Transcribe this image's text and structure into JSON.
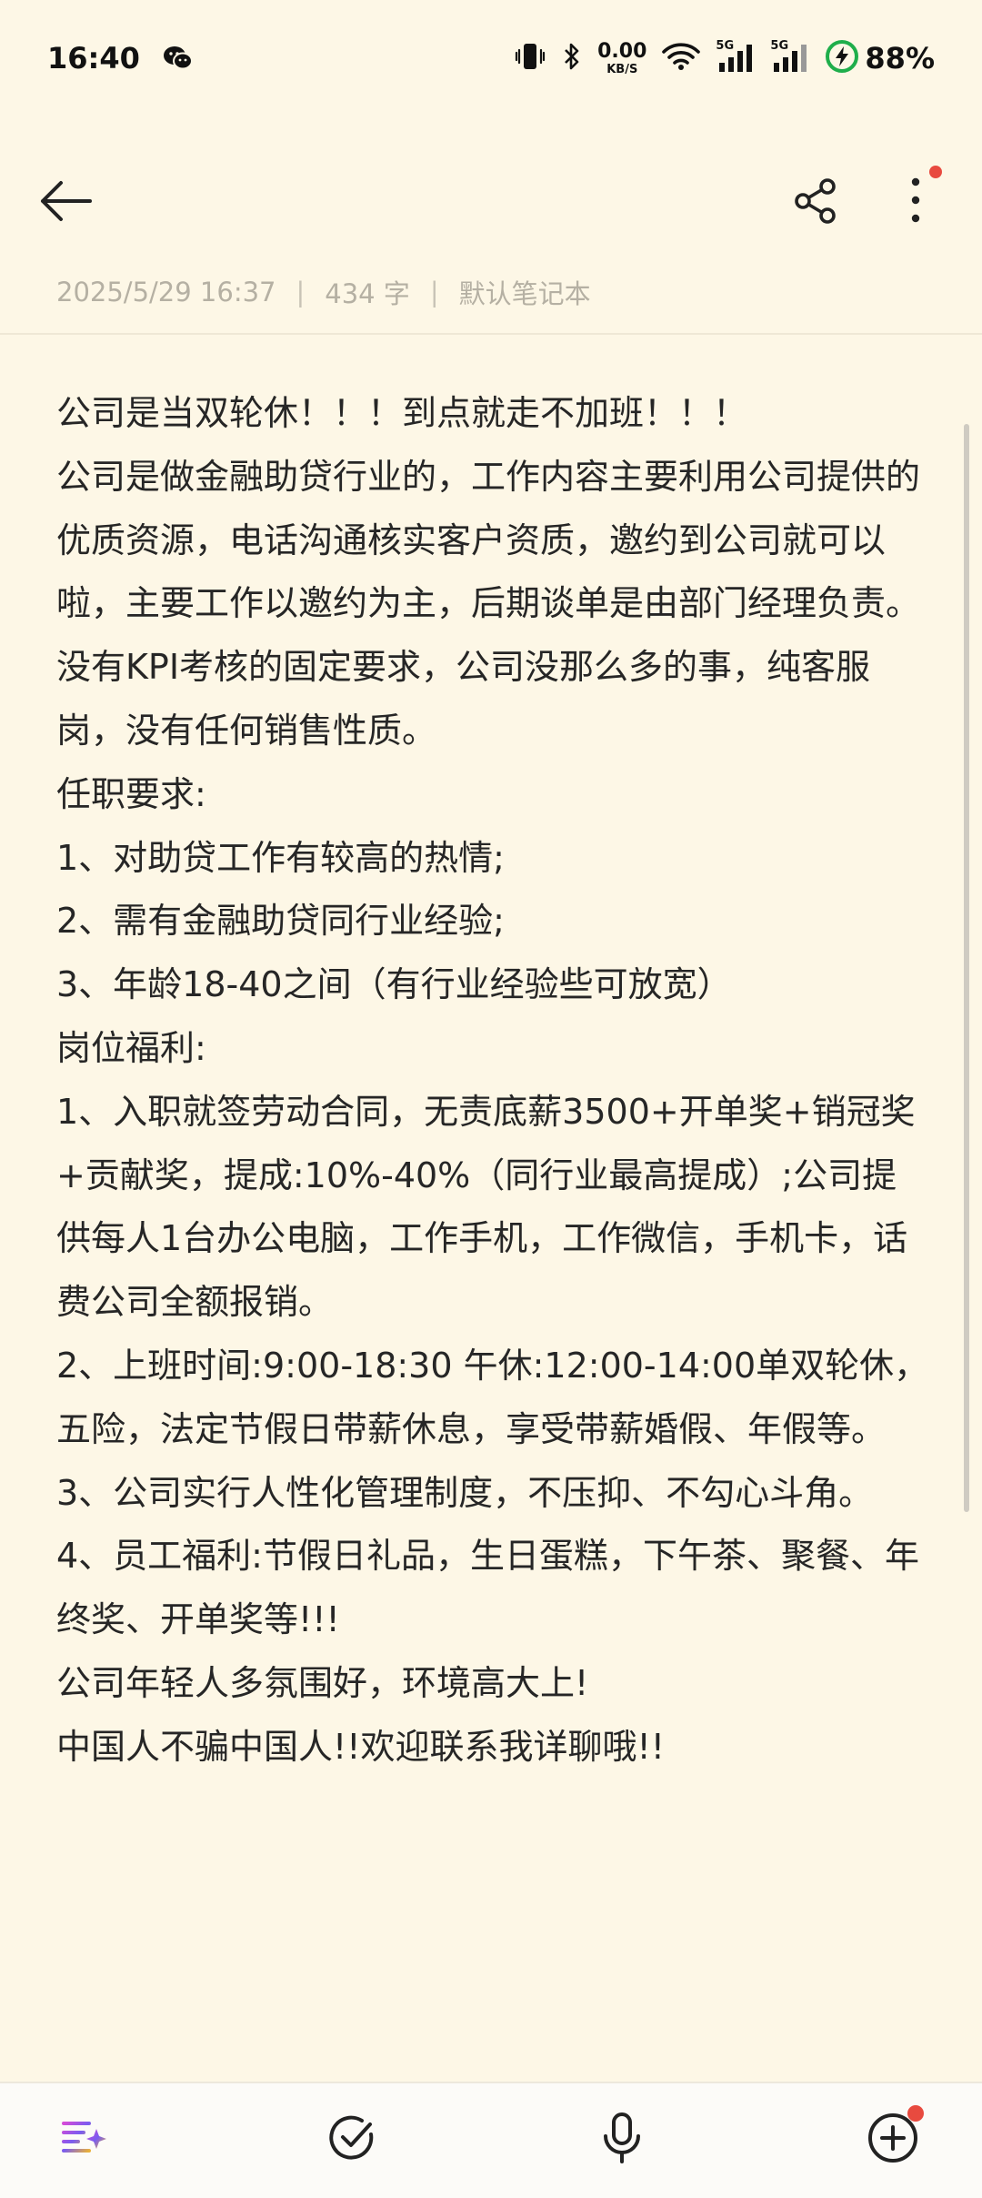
{
  "status_bar": {
    "time": "16:40",
    "net_speed_value": "0.00",
    "net_speed_unit": "KB/S",
    "signal1_tag": "5G",
    "signal2_tag": "5G",
    "battery": "88%"
  },
  "note": {
    "date": "2025/5/29 16:37",
    "word_count": "434 字",
    "notebook": "默认笔记本",
    "separator": "|",
    "lines": [
      "公司是当双轮休！！！到点就走不加班！！！",
      "公司是做金融助贷行业的，工作内容主要利用公司提供的优质资源，电话沟通核实客户资质，邀约到公司就可以啦，主要工作以邀约为主，后期谈单是由部门经理负责。没有KPI考核的固定要求，公司没那么多的事，纯客服岗，没有任何销售性质。",
      "任职要求:",
      "1、对助贷工作有较高的热情;",
      "2、需有金融助贷同行业经验;",
      "3、年龄18-40之间（有行业经验些可放宽）",
      "岗位福利:",
      "1、入职就签劳动合同，无责底薪3500+开单奖+销冠奖+贡献奖，提成:10%-40%（同行业最高提成）;公司提供每人1台办公电脑，工作手机，工作微信，手机卡，话费公司全额报销。",
      "2、上班时间:9:00-18:30 午休:12:00-14:00单双轮休，五险，法定节假日带薪休息，享受带薪婚假、年假等。",
      "3、公司实行人性化管理制度，不压抑、不勾心斗角。",
      "4、员工福利:节假日礼品，生日蛋糕，下午茶、聚餐、年终奖、开单奖等!!!",
      "公司年轻人多氛围好，环境高大上!",
      "中国人不骗中国人!!欢迎联系我详聊哦!!"
    ]
  },
  "icons": {
    "back": "back-arrow-icon",
    "share": "share-icon",
    "more": "more-vertical-icon",
    "format": "text-format-icon",
    "checklist": "checkmark-circle-icon",
    "voice": "microphone-icon",
    "add": "add-circle-icon"
  },
  "colors": {
    "background": "#fdf7e6",
    "notification_dot": "#e84a3f",
    "battery_green": "#1fae4b"
  }
}
